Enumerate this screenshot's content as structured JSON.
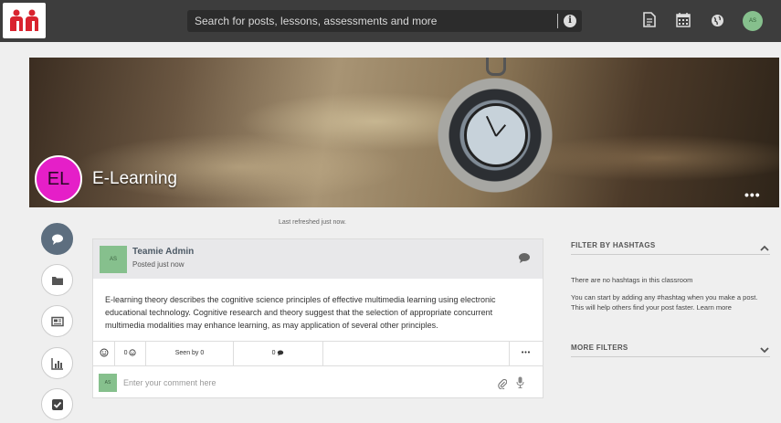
{
  "header": {
    "search_placeholder": "Search for posts, lessons, assessments and more",
    "user_initials": "AS",
    "icons": [
      "logo-icon",
      "info-icon",
      "document-icon",
      "calendar-icon",
      "globe-icon"
    ]
  },
  "banner": {
    "class_initials": "EL",
    "class_name": "E-Learning",
    "more_label": "•••"
  },
  "sidenav": {
    "items": [
      "chat-icon",
      "folder-icon",
      "news-icon",
      "bar-chart-icon",
      "checkbox-icon"
    ]
  },
  "feed": {
    "refreshed": "Last refreshed just now."
  },
  "post": {
    "author": "Teamie Admin",
    "author_initials": "AS",
    "posted": "Posted just now",
    "body": "E-learning theory describes the cognitive science principles of effective multimedia learning using electronic educational technology. Cognitive research and theory suggest that the selection of appropriate concurrent multimedia modalities may enhance learning, as may application of several other principles.",
    "reaction_count": "0",
    "seen_by": "Seen by 0",
    "comment_count": "0",
    "more_label": "•••",
    "comment_placeholder": "Enter your comment here",
    "commenter_initials": "AS"
  },
  "filters": {
    "hashtags_title": "FILTER BY HASHTAGS",
    "no_hashtags": "There are no hashtags in this classroom",
    "hint": "You can start by adding any #hashtag when you make a post. This will help others find your post faster.",
    "learn_more": "Learn more",
    "more_filters_title": "MORE FILTERS"
  },
  "colors": {
    "topbar": "#3d3d3d",
    "logo_red": "#d9232e",
    "badge_magenta": "#e51fc8",
    "avatar_green": "#86c08d",
    "active_nav": "#5d6e7f"
  }
}
